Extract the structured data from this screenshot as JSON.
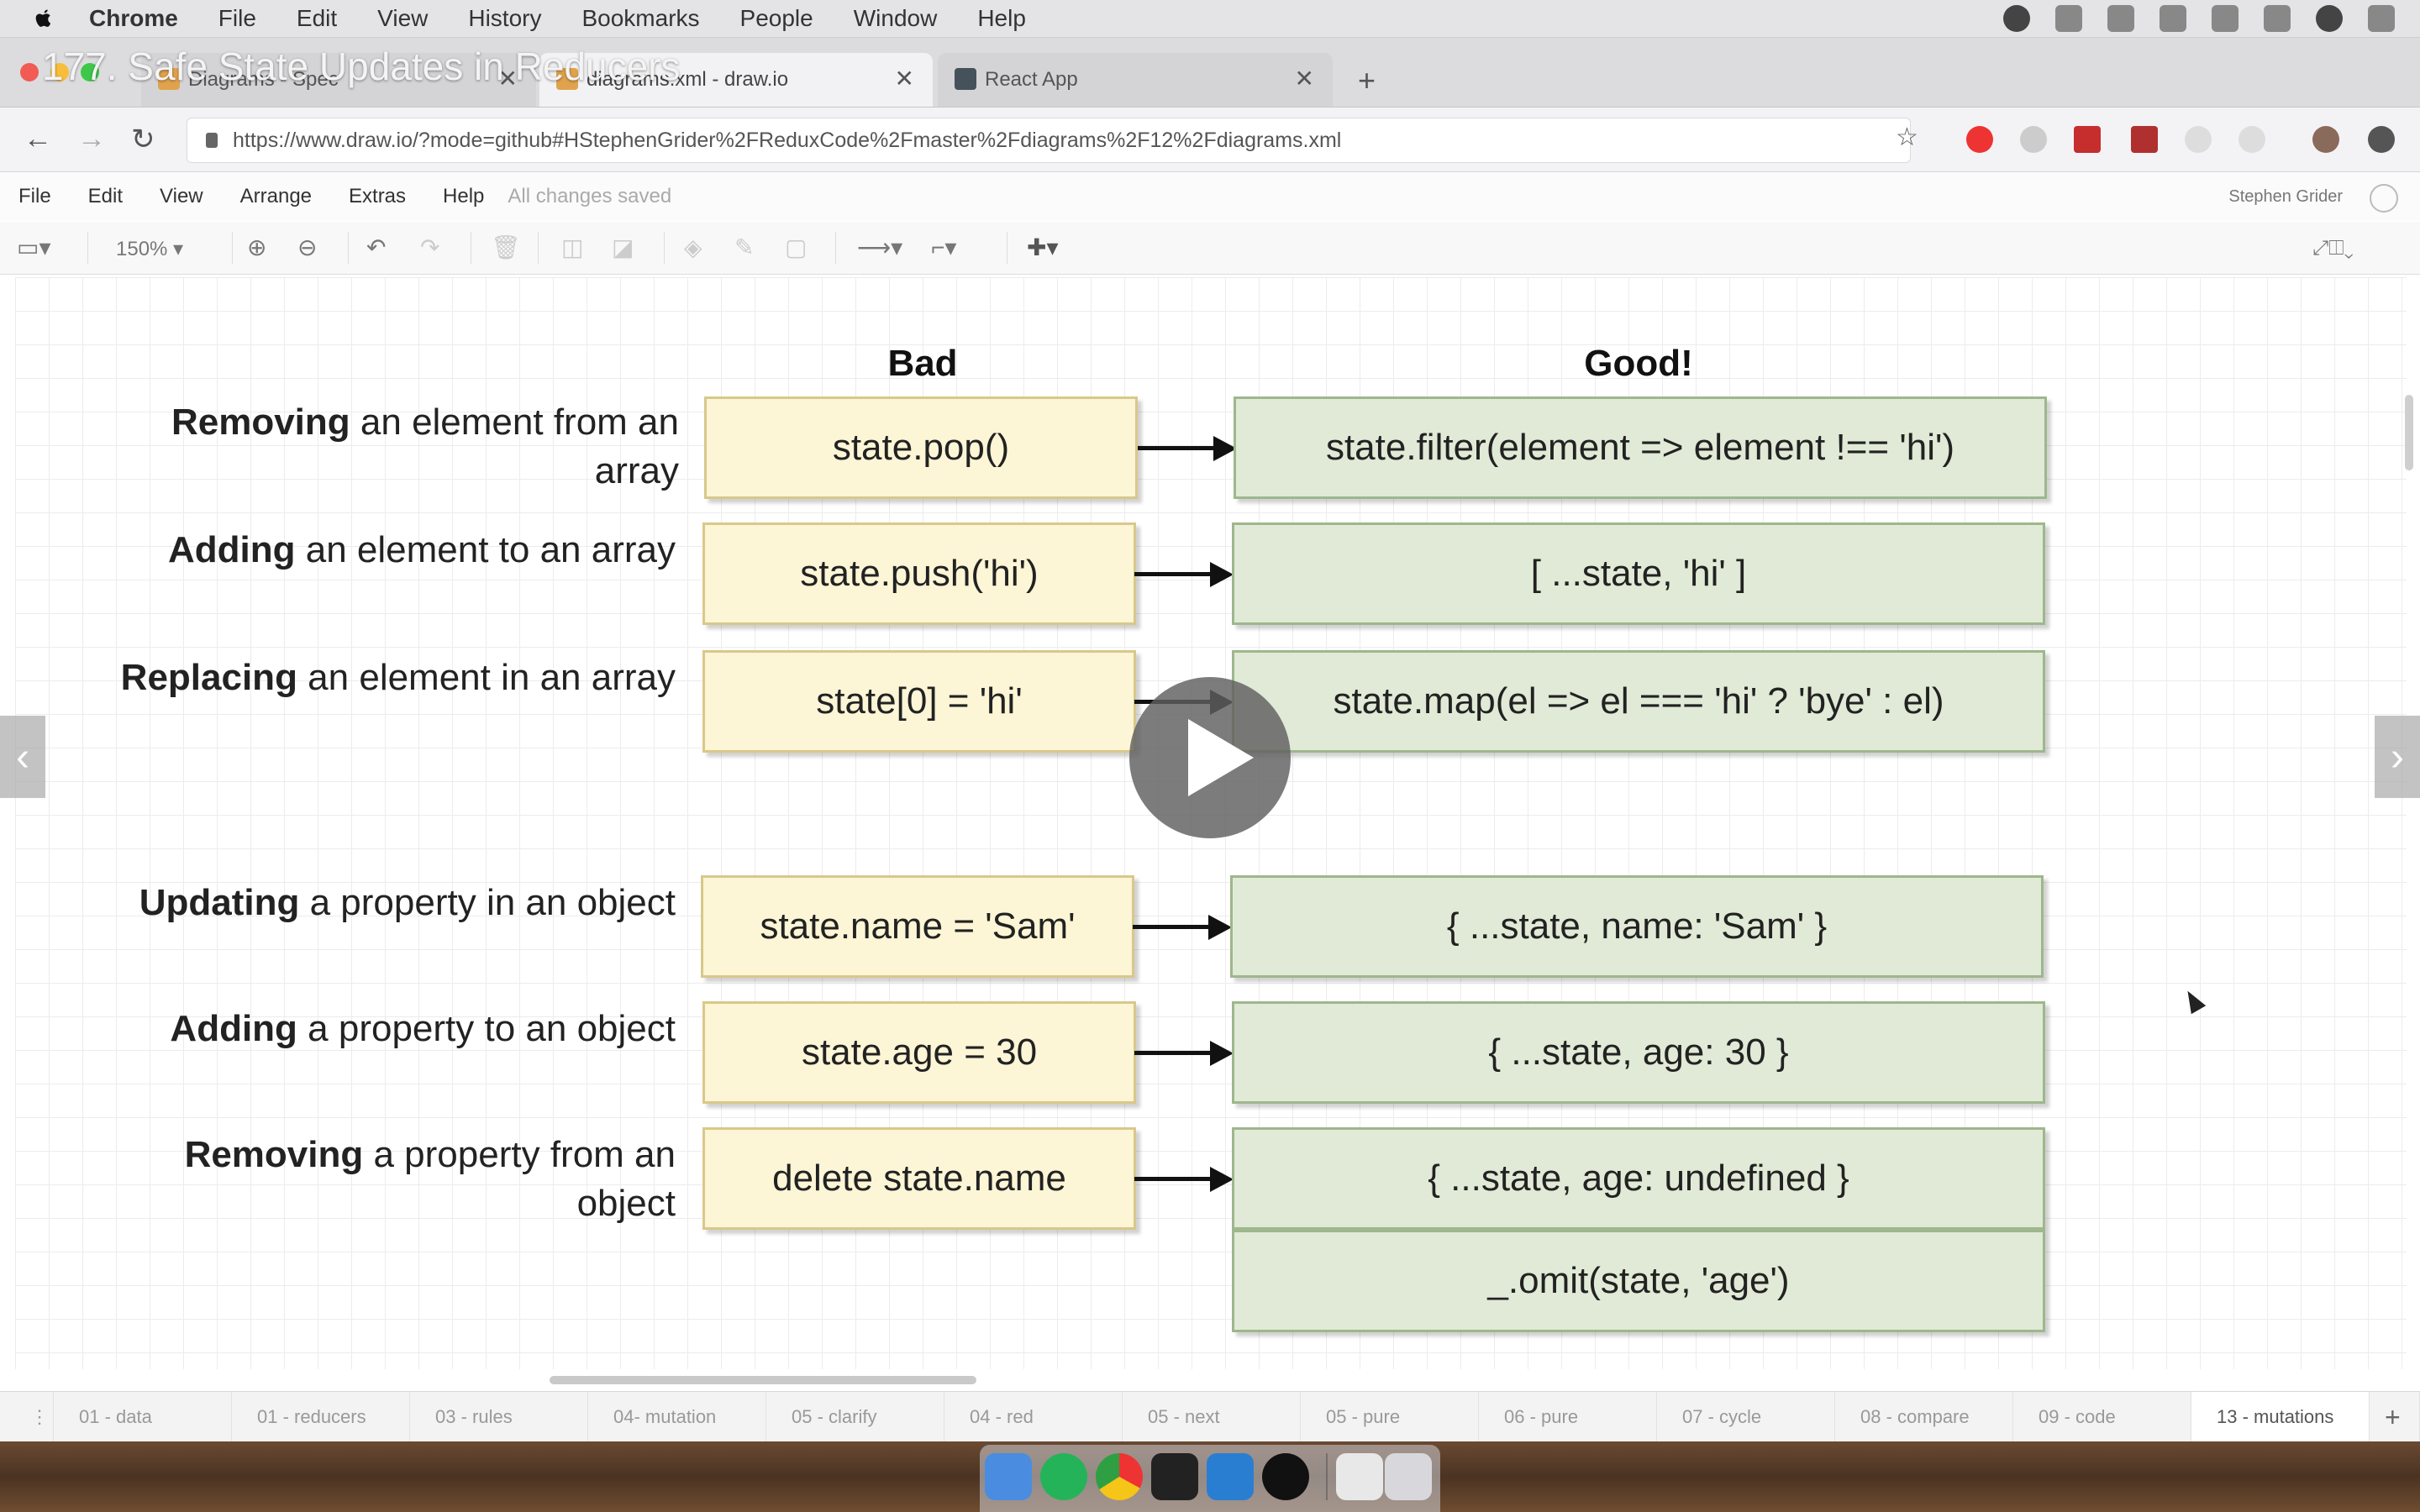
{
  "menubar": {
    "app": "Chrome",
    "items": [
      "File",
      "Edit",
      "View",
      "History",
      "Bookmarks",
      "People",
      "Window",
      "Help"
    ]
  },
  "video_title": "177. Safe State Updates in Reducers",
  "tabs": [
    {
      "label": "Diagrams - Spec",
      "active": false
    },
    {
      "label": "diagrams.xml - draw.io",
      "active": true
    },
    {
      "label": "React App",
      "active": false
    }
  ],
  "address": {
    "url": "https://www.draw.io/?mode=github#HStephenGrider%2FReduxCode%2Fmaster%2Fdiagrams%2F12%2Fdiagrams.xml"
  },
  "drawio_menu": {
    "items": [
      "File",
      "Edit",
      "View",
      "Arrange",
      "Extras",
      "Help"
    ],
    "status": "All changes saved",
    "user": "Stephen Grider"
  },
  "toolbar": {
    "zoom": "150%"
  },
  "diagram": {
    "bad_header": "Bad",
    "good_header": "Good!",
    "rows": [
      {
        "label_bold": "Removing",
        "label_rest": " an element from an array",
        "bad": "state.pop()",
        "good": "state.filter(element => element !== 'hi')"
      },
      {
        "label_bold": "Adding",
        "label_rest": " an element to an array",
        "bad": "state.push('hi')",
        "good": "[ ...state, 'hi' ]"
      },
      {
        "label_bold": "Replacing",
        "label_rest": " an element in an array",
        "bad": "state[0] = 'hi'",
        "good": "state.map(el => el === 'hi' ? 'bye' : el)"
      },
      {
        "label_bold": "Updating",
        "label_rest": " a property in an object",
        "bad": "state.name = 'Sam'",
        "good": "{ ...state, name: 'Sam' }"
      },
      {
        "label_bold": "Adding",
        "label_rest": " a property to an object",
        "bad": "state.age = 30",
        "good": "{ ...state, age: 30 }"
      },
      {
        "label_bold": "Removing",
        "label_rest": " a property from an object",
        "bad": "delete state.name",
        "good": "{ ...state, age: undefined }"
      }
    ],
    "extra_good": "_.omit(state, 'age')"
  },
  "page_tabs": [
    "01 - data",
    "01 - reducers",
    "03 - rules",
    "04- mutation",
    "05 - clarify",
    "04 - red",
    "05 - next",
    "05 - pure",
    "06 - pure",
    "07 - cycle",
    "08 - compare",
    "09 - code",
    "13 - mutations"
  ]
}
